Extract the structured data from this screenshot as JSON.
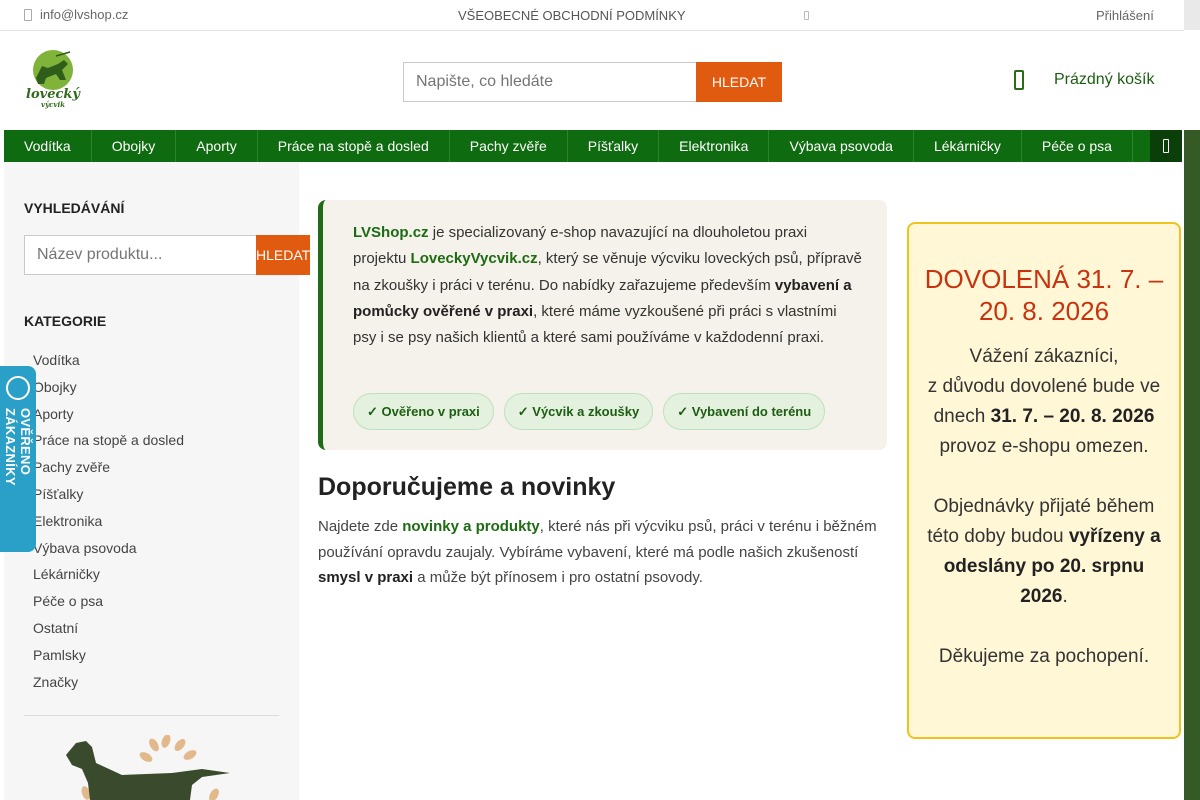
{
  "topbar": {
    "email": "info@lvshop.cz",
    "terms": "VŠEOBECNÉ OBCHODNÍ PODMÍNKY",
    "login": "Přihlášení"
  },
  "header": {
    "logo_text": "lovecký výcvik",
    "search_placeholder": "Napište, co hledáte",
    "search_button": "HLEDAT",
    "cart_label": "Prázdný košík"
  },
  "nav": {
    "items": [
      "Vodítka",
      "Obojky",
      "Aporty",
      "Práce na stopě a dosled",
      "Pachy zvěře",
      "Píšťalky",
      "Elektronika",
      "Výbava psovoda",
      "Lékárničky",
      "Péče o psa"
    ]
  },
  "sidebar": {
    "search_heading": "VYHLEDÁVÁNÍ",
    "search_placeholder": "Název produktu...",
    "search_button": "HLEDAT",
    "categories_heading": "KATEGORIE",
    "categories": [
      "Vodítka",
      "Obojky",
      "Aporty",
      "Práce na stopě a dosled",
      "Pachy zvěře",
      "Píšťalky",
      "Elektronika",
      "Výbava psovoda",
      "Lékárničky",
      "Péče o psa",
      "Ostatní",
      "Pamlsky",
      "Značky"
    ]
  },
  "badge": {
    "text": "OVĚŘENO ZÁKAZNÍKY"
  },
  "intro": {
    "brand": "LVShop.cz",
    "t1": " je specializovaný e-shop navazující na dlouholetou praxi projektu ",
    "project": "LoveckyVycvik.cz",
    "t2": ", který se věnuje výcviku loveckých psů, přípravě na zkoušky i práci v terénu. Do nabídky zařazujeme především ",
    "bold": "vybavení a pomůcky ověřené v praxi",
    "t3": ", které máme vyzkoušené při práci s vlastními psy i se psy našich klientů a které sami používáme v každodenní praxi.",
    "chips": [
      "✓ Ověřeno v praxi",
      "✓ Výcvik a zkoušky",
      "✓ Vybavení do terénu"
    ]
  },
  "recommend": {
    "title": "Doporučujeme a novinky",
    "t1": "Najdete zde ",
    "link": "novinky a produkty",
    "t2": ", které nás při výcviku psů, práci v terénu i běžném používání opravdu zaujaly. Vybíráme vybavení, které má podle našich zkušeností ",
    "bold": "smysl v praxi",
    "t3": " a může být přínosem i pro ostatní psovody."
  },
  "notice": {
    "title": "DOVOLENÁ 31. 7. – 20. 8. 2026",
    "p1a": "Vážení zákazníci,",
    "p1b": "z důvodu dovolené bude ve dnech ",
    "p1bold": "31. 7. – 20. 8. 2026",
    "p1c": " provoz e-shopu omezen.",
    "p2a": "Objednávky přijaté během této doby budou ",
    "p2bold": "vyřízeny a odeslány po 20. srpnu 2026",
    "p2c": ".",
    "p3": "Děkujeme za pochopení."
  },
  "colors": {
    "brand_green": "#0f6b0f",
    "accent_orange": "#e05a0f",
    "notice_red": "#c8330f",
    "notice_border": "#f2c21c",
    "badge_blue": "#2aa0c8"
  },
  "icons": {
    "mail": "envelope-icon",
    "cart": "cart-icon",
    "menu_more": "menu-icon",
    "badge_seal": "verified-seal-icon"
  }
}
